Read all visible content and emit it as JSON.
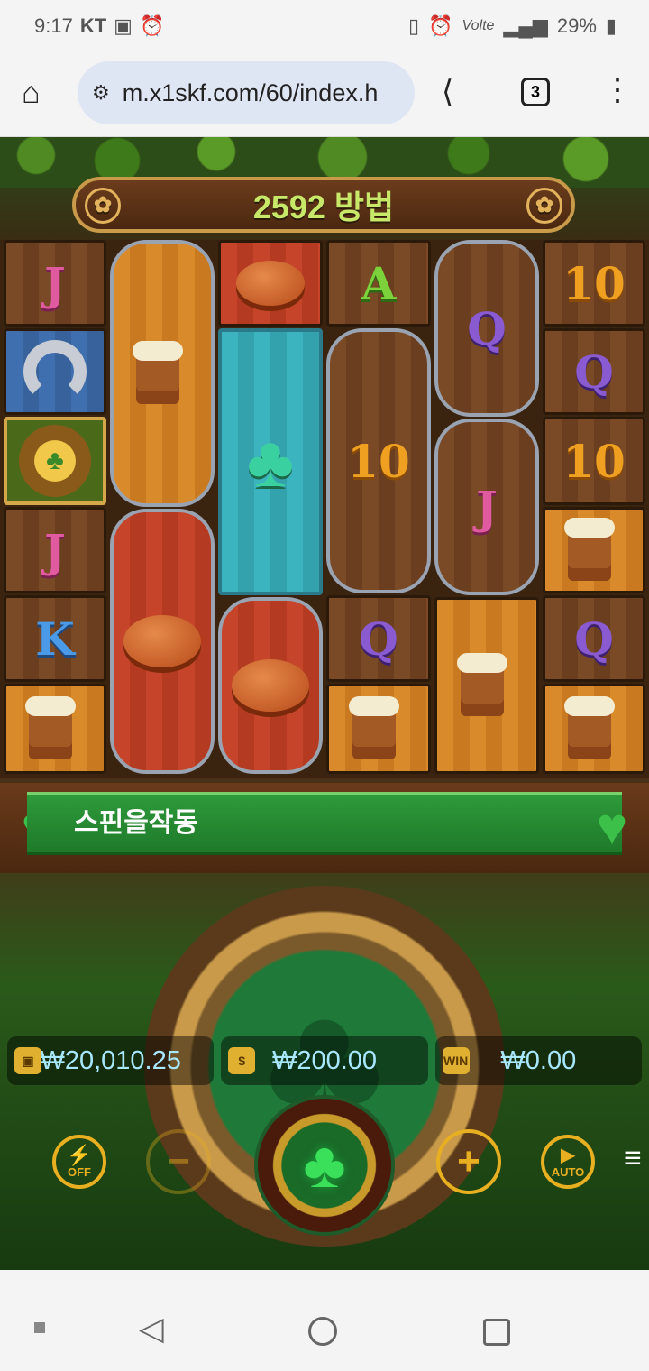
{
  "status_bar": {
    "time": "9:17",
    "carrier": "KT",
    "volte": "Volte",
    "battery": "29%"
  },
  "browser": {
    "url": "m.x1skf.com/60/index.h",
    "tab_count": "3"
  },
  "game": {
    "ways_banner": "2592 방법",
    "message": "스핀을작동",
    "balance": "₩20,010.25",
    "bet": "₩200.00",
    "win": "₩0.00",
    "win_badge": "WIN",
    "turbo_label": "OFF",
    "auto_label": "AUTO",
    "reels": [
      [
        "J",
        "horseshoe",
        "scatter",
        "J",
        "K",
        "beer"
      ],
      [
        "beer",
        "bread"
      ],
      [
        "bread",
        "clover",
        "bread"
      ],
      [
        "A",
        "10",
        "Q",
        "beer"
      ],
      [
        "Q",
        "J",
        "beer"
      ],
      [
        "10",
        "Q",
        "10",
        "beer",
        "Q",
        "beer"
      ]
    ]
  },
  "icons": [
    "home-icon",
    "site-info-icon",
    "share-icon",
    "tab-count-icon",
    "overflow-menu-icon",
    "bet-decrease-icon",
    "bet-increase-icon",
    "spin-icon",
    "auto-icon",
    "turbo-icon",
    "hamburger-icon"
  ],
  "nav_bar": [
    "recents",
    "back",
    "home",
    "overview"
  ]
}
